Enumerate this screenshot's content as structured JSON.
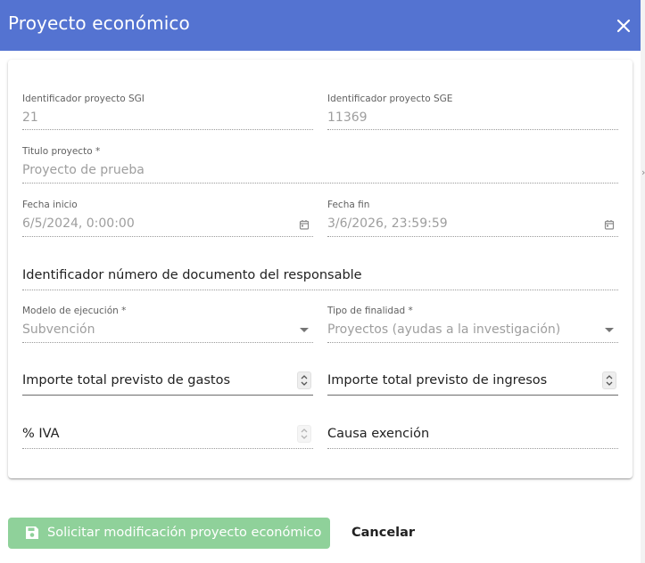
{
  "dialog": {
    "title": "Proyecto económico"
  },
  "form": {
    "id_sgi": {
      "label": "Identificador proyecto SGI",
      "value": "21"
    },
    "id_sge": {
      "label": "Identificador proyecto SGE",
      "value": "11369"
    },
    "titulo": {
      "label": "Titulo proyecto *",
      "value": "Proyecto de prueba"
    },
    "fecha_inicio": {
      "label": "Fecha inicio",
      "value": "6/5/2024, 0:00:00"
    },
    "fecha_fin": {
      "label": "Fecha fin",
      "value": "3/6/2026, 23:59:59"
    },
    "doc_responsable": {
      "placeholder": "Identificador número de documento del responsable"
    },
    "modelo_ejecucion": {
      "label": "Modelo de ejecución *",
      "value": "Subvención"
    },
    "tipo_finalidad": {
      "label": "Tipo de finalidad *",
      "value": "Proyectos (ayudas a la investigación)"
    },
    "importe_gastos": {
      "placeholder": "Importe total previsto de gastos"
    },
    "importe_ingresos": {
      "placeholder": "Importe total previsto de ingresos"
    },
    "iva": {
      "placeholder": "% IVA"
    },
    "causa_exencion": {
      "placeholder": "Causa exención"
    }
  },
  "actions": {
    "submit_label": "Solicitar modificación proyecto económico",
    "cancel_label": "Cancelar"
  },
  "colors": {
    "header_bg": "#5473d1",
    "submit_bg_disabled": "#8fd19a"
  },
  "icons": {
    "close": "close-icon",
    "calendar": "calendar-icon",
    "dropdown": "chevron-down-icon",
    "spinner": "number-spinner-icon",
    "save": "save-icon"
  }
}
